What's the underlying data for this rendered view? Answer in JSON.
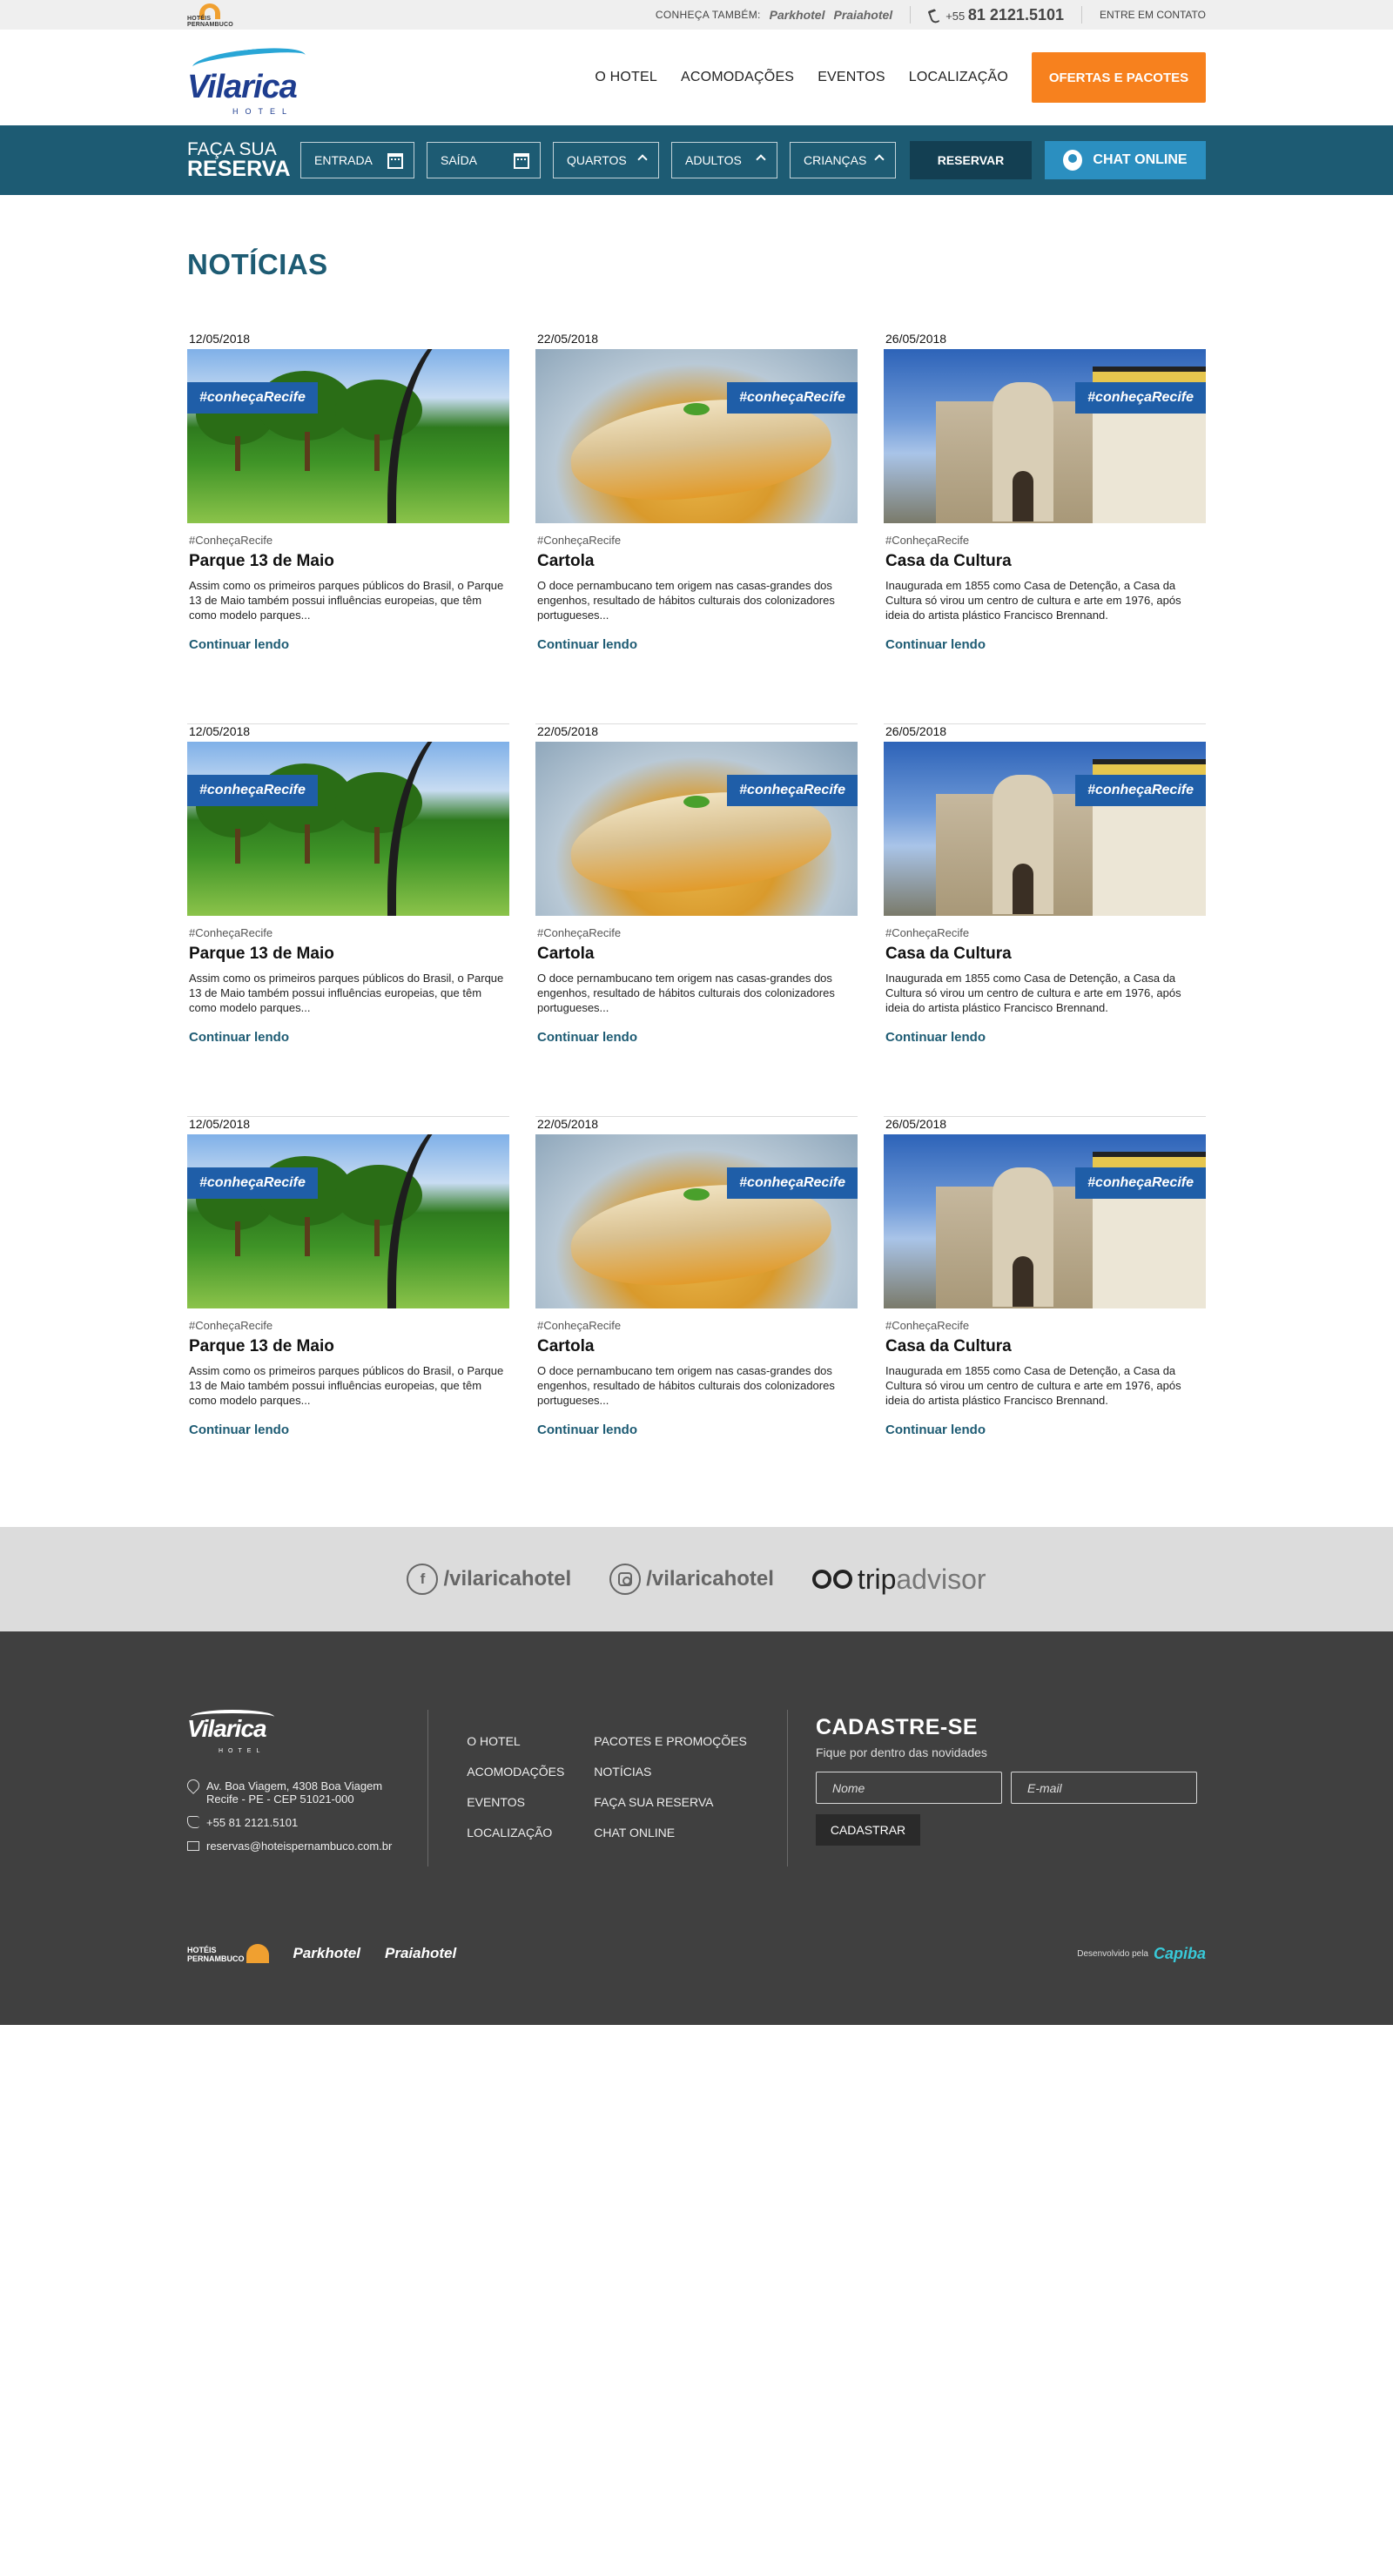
{
  "topbar": {
    "group_logo_text": "HOTÉIS PERNAMBUCO",
    "see_also_label": "CONHEÇA TAMBÉM:",
    "brand1": "Parkhotel",
    "brand2": "Praiahotel",
    "phone_prefix": "+55",
    "phone_number": "81 2121.5101",
    "contact_label": "ENTRE EM CONTATO"
  },
  "header": {
    "logo_name": "Vilarica",
    "logo_sub": "HOTEL",
    "nav": [
      "O HOTEL",
      "ACOMODAÇÕES",
      "EVENTOS",
      "LOCALIZAÇÃO"
    ],
    "offers_label": "OFERTAS E PACOTES"
  },
  "booking": {
    "title_line1": "FAÇA SUA",
    "title_line2": "RESERVA",
    "checkin": "ENTRADA",
    "checkout": "SAÍDA",
    "rooms": "QUARTOS",
    "adults": "ADULTOS",
    "children": "CRIANÇAS",
    "reserve_label": "RESERVAR",
    "chat_label": "CHAT ONLINE"
  },
  "news": {
    "page_title": "NOTÍCIAS",
    "tag_banner": "#conheçaRecife",
    "read_more": "Continuar lendo",
    "items": [
      {
        "date": "12/05/2018",
        "tag": "#ConheçaRecife",
        "title": "Parque 13 de Maio",
        "excerpt": "Assim como os primeiros parques públicos do Brasil, o Parque 13 de Maio também possui influências europeias, que têm como modelo parques..."
      },
      {
        "date": "22/05/2018",
        "tag": "#ConheçaRecife",
        "title": "Cartola",
        "excerpt": "O doce pernambucano tem origem nas casas-grandes dos engenhos, resultado de hábitos culturais dos colonizadores portugueses..."
      },
      {
        "date": "26/05/2018",
        "tag": "#ConheçaRecife",
        "title": "Casa da Cultura",
        "excerpt": "Inaugurada em 1855 como Casa de Detenção, a Casa da Cultura só virou um centro de cultura e arte em 1976, após ideia do artista plástico Francisco Brennand."
      },
      {
        "date": "12/05/2018",
        "tag": "#ConheçaRecife",
        "title": "Parque 13 de Maio",
        "excerpt": "Assim como os primeiros parques públicos do Brasil, o Parque 13 de Maio também possui influências europeias, que têm como modelo parques..."
      },
      {
        "date": "22/05/2018",
        "tag": "#ConheçaRecife",
        "title": "Cartola",
        "excerpt": "O doce pernambucano tem origem nas casas-grandes dos engenhos, resultado de hábitos culturais dos colonizadores portugueses..."
      },
      {
        "date": "26/05/2018",
        "tag": "#ConheçaRecife",
        "title": "Casa da Cultura",
        "excerpt": "Inaugurada em 1855 como Casa de Detenção, a Casa da Cultura só virou um centro de cultura e arte em 1976, após ideia do artista plástico Francisco Brennand."
      },
      {
        "date": "12/05/2018",
        "tag": "#ConheçaRecife",
        "title": "Parque 13 de Maio",
        "excerpt": "Assim como os primeiros parques públicos do Brasil, o Parque 13 de Maio também possui influências europeias, que têm como modelo parques..."
      },
      {
        "date": "22/05/2018",
        "tag": "#ConheçaRecife",
        "title": "Cartola",
        "excerpt": "O doce pernambucano tem origem nas casas-grandes dos engenhos, resultado de hábitos culturais dos colonizadores portugueses..."
      },
      {
        "date": "26/05/2018",
        "tag": "#ConheçaRecife",
        "title": "Casa da Cultura",
        "excerpt": "Inaugurada em 1855 como Casa de Detenção, a Casa da Cultura só virou um centro de cultura e arte em 1976, após ideia do artista plástico Francisco Brennand."
      }
    ]
  },
  "social": {
    "facebook": "/vilaricahotel",
    "instagram": "/vilaricahotel",
    "tripadvisor_a": "trip",
    "tripadvisor_b": "advisor"
  },
  "footer": {
    "logo_name": "Vilarica",
    "logo_sub": "HOTEL",
    "address_line1": "Av. Boa Viagem, 4308 Boa Viagem",
    "address_line2": "Recife - PE - CEP 51021-000",
    "phone": "+55 81 2121.5101",
    "email": "reservas@hoteispernambuco.com.br",
    "links_col1": [
      "O HOTEL",
      "ACOMODAÇÕES",
      "EVENTOS",
      "LOCALIZAÇÃO"
    ],
    "links_col2": [
      "PACOTES E PROMOÇÕES",
      "NOTÍCIAS",
      "FAÇA SUA RESERVA",
      "CHAT ONLINE"
    ],
    "newsletter_title": "CADASTRE-SE",
    "newsletter_sub": "Fique por dentro das novidades",
    "name_placeholder": "Nome",
    "email_placeholder": "E-mail",
    "subscribe_label": "CADASTRAR",
    "brand_hp_line1": "HOTÉIS",
    "brand_hp_line2": "PERNAMBUCO",
    "brand_park": "Parkhotel",
    "brand_praia": "Praiahotel",
    "dev_label": "Desenvolvido pela",
    "dev_name": "Capiba"
  }
}
